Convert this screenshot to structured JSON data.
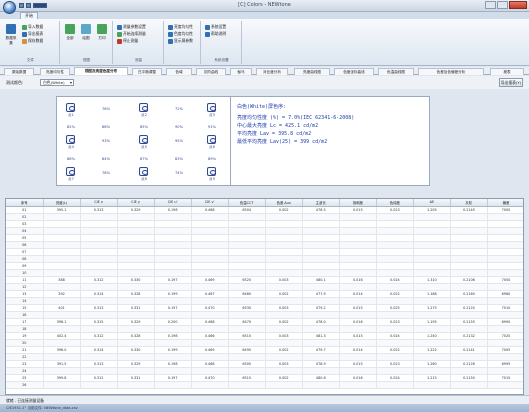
{
  "window": {
    "title": "[C] Colors - NEWtone"
  },
  "ribbon": {
    "tab_label": "开始",
    "groups": [
      {
        "label": "文件",
        "big_label": "数据采集",
        "small_items": [
          "导入数据",
          "导出报表",
          "保存数据"
        ]
      },
      {
        "label": "视图",
        "big_items": [
          "全部",
          "绘图",
          "打印"
        ]
      },
      {
        "label": "测量",
        "small_items": [
          "测量参数设置",
          "开始连续测量",
          "停止测量"
        ]
      },
      {
        "label": "",
        "small_items": [
          "亮度均匀性",
          "色度均匀性",
          "显示屏参数"
        ]
      },
      {
        "label": "系统设置",
        "small_items": [
          "系统设置",
          "帮助说明"
        ]
      }
    ],
    "colors": {
      "accent": "#2f6fb3",
      "green": "#4aa35a",
      "orange": "#d9903a"
    }
  },
  "view_tabs": [
    "原始数据",
    "亮度均匀性",
    "视图及亮度色度分布",
    "白平衡调整",
    "色域",
    "灰阶曲线",
    "伽马",
    "对比度分析",
    "亮度曲线图",
    "色度坐标曲线",
    "色温曲线图",
    "色差及色偏差分析",
    "报表"
  ],
  "filter": {
    "label": "测试颜色:",
    "selected": "白色(White)",
    "button": "导出报表(Y)"
  },
  "grid_panel": {
    "points": [
      {
        "label": "点1"
      },
      {
        "label": "点2"
      },
      {
        "label": "点3"
      },
      {
        "label": "点4"
      },
      {
        "label": "点5"
      },
      {
        "label": "点6"
      },
      {
        "label": "点7"
      },
      {
        "label": "点8"
      },
      {
        "label": "点9"
      }
    ],
    "values": [
      [
        "76%",
        "72%"
      ],
      [
        "82%",
        "85%"
      ],
      [
        "88%",
        "90%",
        "91%",
        "89%"
      ],
      [
        "93%",
        "95%"
      ],
      [
        "86%",
        "84%",
        "87%",
        "83%"
      ],
      [
        "78%",
        "74%"
      ]
    ]
  },
  "info_panel": {
    "lines": [
      "白色(White)屏色序:",
      "亮度均匀性度 (%) = 7.0%(IEC 62341-6-2008)",
      "中心最大亮度 Lc = 425.1 cd/m2",
      "平均亮度 Lav = 395.8 cd/m2",
      "最低平均亮度 Lav(25) = 399 cd/m2"
    ]
  },
  "table": {
    "headers": [
      "序号",
      "亮度(L)",
      "CIE x",
      "CIE y",
      "CIE u'",
      "CIE v'",
      "色温CCT",
      "色差 Δuv",
      "主波长",
      "饱和度",
      "色纯度",
      "ΔE",
      "灰阶",
      "偏差"
    ],
    "rows": [
      [
        "01",
        "395.1",
        "0.313",
        "0.329",
        "0.198",
        "0.468",
        "6504",
        "0.002",
        "478.5",
        "0.015",
        "0.023",
        "1.205",
        "0.2145",
        "7000"
      ],
      [
        "02",
        "",
        "",
        "",
        "",
        "",
        "",
        "",
        "",
        "",
        "",
        "",
        "",
        ""
      ],
      [
        "03",
        "",
        "",
        "",
        "",
        "",
        "",
        "",
        "",
        "",
        "",
        "",
        "",
        ""
      ],
      [
        "04",
        "",
        "",
        "",
        "",
        "",
        "",
        "",
        "",
        "",
        "",
        "",
        "",
        ""
      ],
      [
        "05",
        "",
        "",
        "",
        "",
        "",
        "",
        "",
        "",
        "",
        "",
        "",
        "",
        ""
      ],
      [
        "06",
        "",
        "",
        "",
        "",
        "",
        "",
        "",
        "",
        "",
        "",
        "",
        "",
        ""
      ],
      [
        "07",
        "",
        "",
        "",
        "",
        "",
        "",
        "",
        "",
        "",
        "",
        "",
        "",
        ""
      ],
      [
        "08",
        "",
        "",
        "",
        "",
        "",
        "",
        "",
        "",
        "",
        "",
        "",
        "",
        ""
      ],
      [
        "09",
        "",
        "",
        "",
        "",
        "",
        "",
        "",
        "",
        "",
        "",
        "",
        "",
        ""
      ],
      [
        "10",
        "",
        "",
        "",
        "",
        "",
        "",
        "",
        "",
        "",
        "",
        "",
        "",
        ""
      ],
      [
        "11",
        "388",
        "0.312",
        "0.330",
        "0.197",
        "0.469",
        "6520",
        "0.003",
        "480.1",
        "0.016",
        "0.024",
        "1.310",
        "0.2106",
        "7050"
      ],
      [
        "12",
        "",
        "",
        "",
        "",
        "",
        "",
        "",
        "",
        "",
        "",
        "",
        "",
        ""
      ],
      [
        "13",
        "392",
        "0.314",
        "0.328",
        "0.199",
        "0.467",
        "6480",
        "0.002",
        "477.9",
        "0.014",
        "0.022",
        "1.188",
        "0.2160",
        "6980"
      ],
      [
        "14",
        "",
        "",
        "",
        "",
        "",
        "",
        "",
        "",
        "",
        "",
        "",
        "",
        ""
      ],
      [
        "15",
        "401",
        "0.313",
        "0.331",
        "0.197",
        "0.470",
        "6530",
        "0.003",
        "479.2",
        "0.015",
        "0.025",
        "1.275",
        "0.2120",
        "7010"
      ],
      [
        "16",
        "",
        "",
        "",
        "",
        "",
        "",
        "",
        "",
        "",
        "",
        "",
        "",
        ""
      ],
      [
        "17",
        "398.1",
        "0.315",
        "0.329",
        "0.200",
        "0.468",
        "6470",
        "0.002",
        "478.0",
        "0.016",
        "0.023",
        "1.195",
        "0.2155",
        "6990"
      ],
      [
        "18",
        "",
        "",
        "",
        "",
        "",
        "",
        "",
        "",
        "",
        "",
        "",
        "",
        ""
      ],
      [
        "19",
        "402.4",
        "0.312",
        "0.328",
        "0.198",
        "0.466",
        "6510",
        "0.003",
        "481.3",
        "0.015",
        "0.024",
        "1.240",
        "0.2132",
        "7020"
      ],
      [
        "20",
        "",
        "",
        "",
        "",
        "",
        "",
        "",
        "",
        "",
        "",
        "",
        "",
        ""
      ],
      [
        "21",
        "396.0",
        "0.314",
        "0.330",
        "0.199",
        "0.469",
        "6495",
        "0.002",
        "479.7",
        "0.014",
        "0.022",
        "1.222",
        "0.2141",
        "7005"
      ],
      [
        "22",
        "",
        "",
        "",
        "",
        "",
        "",
        "",
        "",
        "",
        "",
        "",
        "",
        ""
      ],
      [
        "23",
        "391.5",
        "0.313",
        "0.329",
        "0.198",
        "0.468",
        "6500",
        "0.003",
        "478.9",
        "0.015",
        "0.023",
        "1.260",
        "0.2128",
        "6995"
      ],
      [
        "24",
        "",
        "",
        "",
        "",
        "",
        "",
        "",
        "",
        "",
        "",
        "",
        "",
        ""
      ],
      [
        "25",
        "399.8",
        "0.312",
        "0.331",
        "0.197",
        "0.470",
        "6515",
        "0.002",
        "480.6",
        "0.016",
        "0.024",
        "1.215",
        "0.2150",
        "7015"
      ],
      [
        "26",
        "",
        "",
        "",
        "",
        "",
        "",
        "",
        "",
        "",
        "",
        "",
        "",
        ""
      ]
    ]
  },
  "status": {
    "text": "就绪 - 已连接测量设备",
    "bottom": "CIE1931 2°  当前文件: NEWtone_data.csv"
  }
}
